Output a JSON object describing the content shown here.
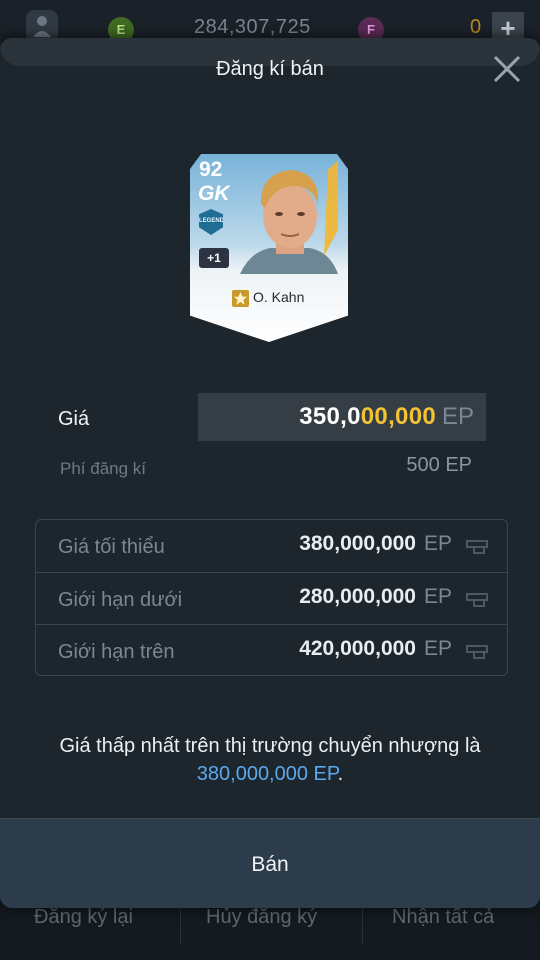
{
  "topbar": {
    "e_coin": "E",
    "balance": "284,307,725",
    "f_coin": "F",
    "f_balance": "0",
    "plus": "+"
  },
  "bottom_tabs": [
    "Đăng ký lại",
    "Hủy đăng ký",
    "Nhận tất cả"
  ],
  "modal": {
    "title": "Đăng kí bán"
  },
  "player_card": {
    "rating": "92",
    "position": "GK",
    "badge": "LEGEND",
    "upgrade": "+1",
    "name": "O. Kahn"
  },
  "price": {
    "label": "Giá",
    "value_prefix": "350,0",
    "value_highlight": "00,000",
    "currency": "EP"
  },
  "fee": {
    "label": "Phí đăng kí",
    "value": "500 EP"
  },
  "info_rows": [
    {
      "label": "Giá tối thiểu",
      "value": "380,000,000",
      "currency": "EP"
    },
    {
      "label": "Giới hạn dưới",
      "value": "280,000,000",
      "currency": "EP"
    },
    {
      "label": "Giới hạn trên",
      "value": "420,000,000",
      "currency": "EP"
    }
  ],
  "notice": {
    "text": "Giá thấp nhất trên thị trường chuyển nhượng là",
    "price": "380,000,000 EP",
    "end": "."
  },
  "sell_button": "Bán",
  "colors": {
    "highlight_yellow": "#f1c233",
    "link_blue": "#5aa9ee",
    "modal_bg": "#1e262d",
    "button_bg": "#2d3c4b"
  }
}
